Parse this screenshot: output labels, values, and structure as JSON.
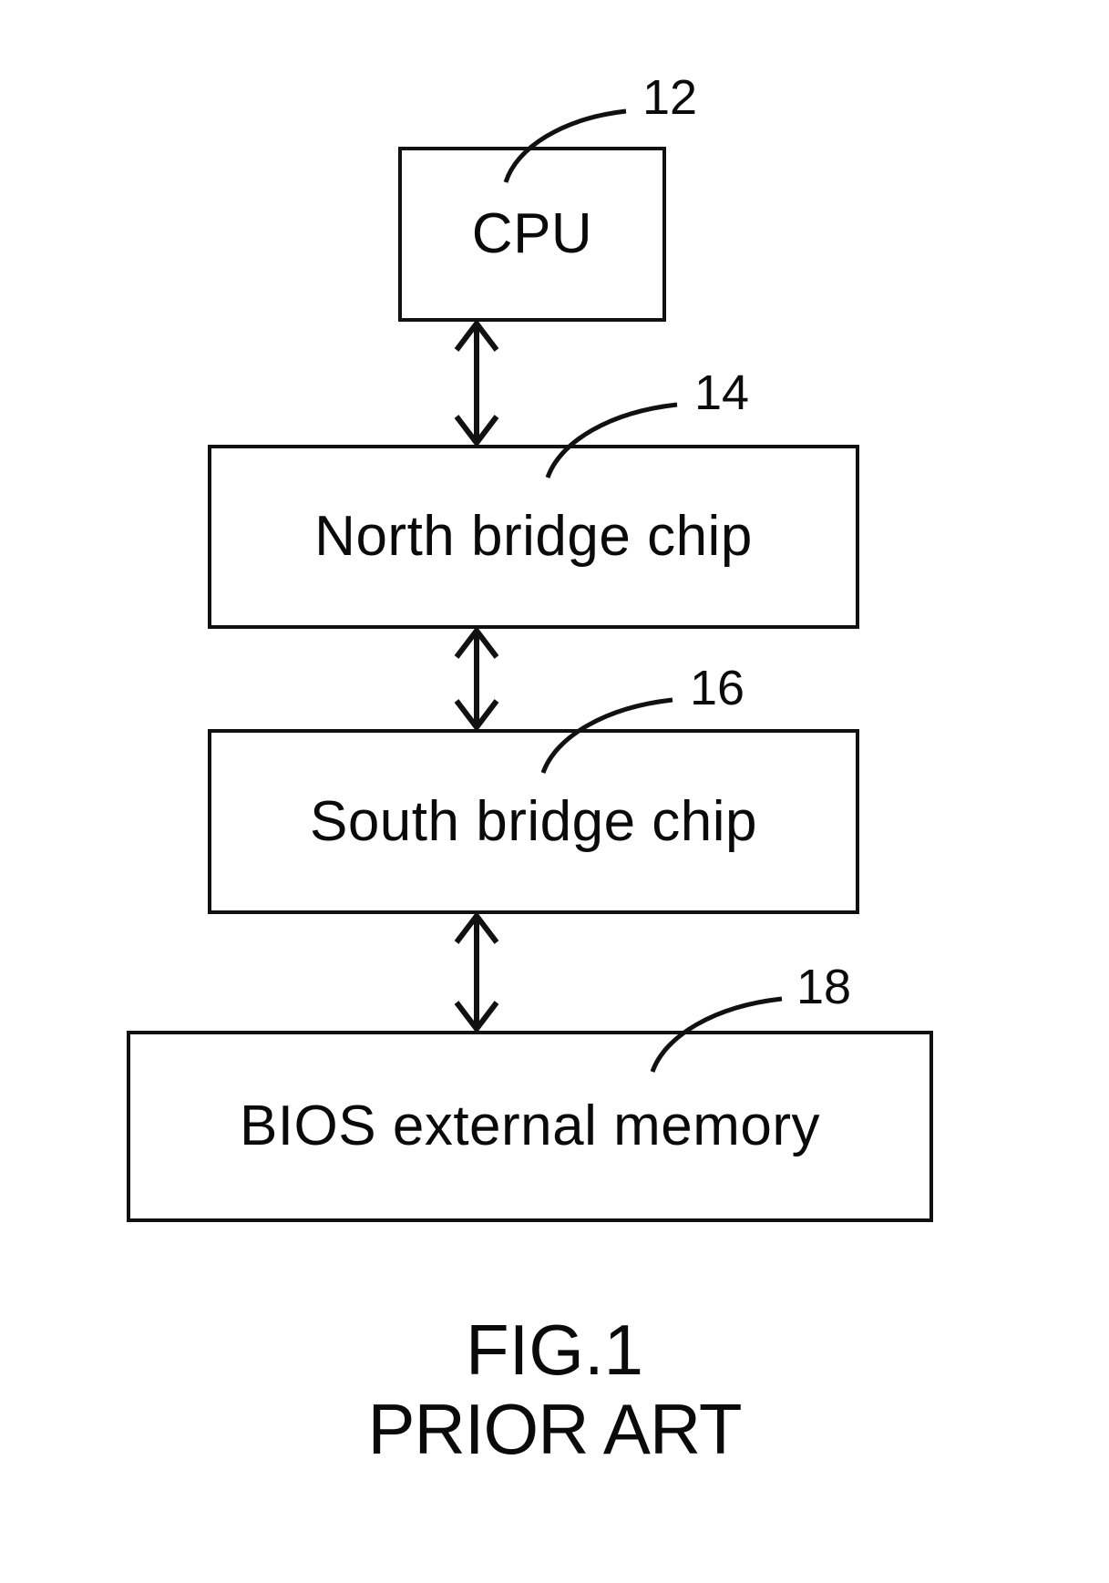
{
  "figure": {
    "caption_title": "FIG.1",
    "caption_subtitle": "PRIOR ART",
    "ink_color": "#0a0a0a",
    "background_color": "#ffffff"
  },
  "blocks": [
    {
      "id": "cpu",
      "label": "CPU",
      "ref": "12"
    },
    {
      "id": "north",
      "label": "North bridge chip",
      "ref": "14"
    },
    {
      "id": "south",
      "label": "South bridge chip",
      "ref": "16"
    },
    {
      "id": "bios",
      "label": "BIOS external memory",
      "ref": "18"
    }
  ],
  "connectors": [
    {
      "id": "cpu-north",
      "from": "cpu",
      "to": "north",
      "style": "double-headed-arrow"
    },
    {
      "id": "north-south",
      "from": "north",
      "to": "south",
      "style": "double-headed-arrow"
    },
    {
      "id": "south-bios",
      "from": "south",
      "to": "bios",
      "style": "double-headed-arrow"
    }
  ]
}
